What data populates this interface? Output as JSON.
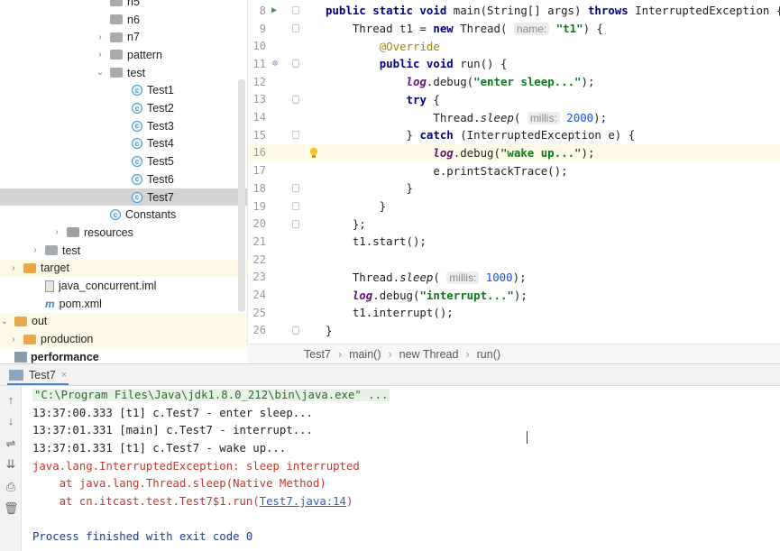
{
  "tree": {
    "items": [
      {
        "label": "n5",
        "indent": 8,
        "arrow": "",
        "icon": "package-icon"
      },
      {
        "label": "n6",
        "indent": 8,
        "arrow": "",
        "icon": "package-icon"
      },
      {
        "label": "n7",
        "indent": 8,
        "arrow": "›",
        "icon": "package-icon"
      },
      {
        "label": "pattern",
        "indent": 8,
        "arrow": "›",
        "icon": "package-icon"
      },
      {
        "label": "test",
        "indent": 8,
        "arrow": "⌄",
        "icon": "package-icon"
      },
      {
        "label": "Test1",
        "indent": 10,
        "arrow": "",
        "icon": "class-icon"
      },
      {
        "label": "Test2",
        "indent": 10,
        "arrow": "",
        "icon": "class-icon"
      },
      {
        "label": "Test3",
        "indent": 10,
        "arrow": "",
        "icon": "class-icon"
      },
      {
        "label": "Test4",
        "indent": 10,
        "arrow": "",
        "icon": "class-icon"
      },
      {
        "label": "Test5",
        "indent": 10,
        "arrow": "",
        "icon": "class-icon"
      },
      {
        "label": "Test6",
        "indent": 10,
        "arrow": "",
        "icon": "class-icon"
      },
      {
        "label": "Test7",
        "indent": 10,
        "arrow": "",
        "icon": "class-icon"
      },
      {
        "label": "Constants",
        "indent": 8,
        "arrow": "",
        "icon": "class-icon"
      },
      {
        "label": "resources",
        "indent": 4,
        "arrow": "›",
        "icon": "resources-folder-icon"
      },
      {
        "label": "test",
        "indent": 2,
        "arrow": "›",
        "icon": "folder-icon"
      },
      {
        "label": "target",
        "indent": 0,
        "arrow": "›",
        "icon": "excluded-folder-icon"
      },
      {
        "label": "java_concurrent.iml",
        "indent": 2,
        "arrow": "",
        "icon": "iml-file-icon"
      },
      {
        "label": "pom.xml",
        "indent": 2,
        "arrow": "",
        "icon": "maven-icon"
      },
      {
        "label": "out",
        "indent": -1,
        "arrow": "⌄",
        "icon": "excluded-folder-icon"
      },
      {
        "label": "production",
        "indent": 0,
        "arrow": "›",
        "icon": "excluded-folder-icon"
      },
      {
        "label": "performance",
        "indent": -1,
        "arrow": "",
        "icon": "module-icon"
      }
    ]
  },
  "editor": {
    "lines": [
      {
        "n": "8",
        "html": "<span class=\"kw\">public static void</span> main(String[] args) <span class=\"kw\">throws</span> InterruptedException {"
      },
      {
        "n": "9",
        "html": "    Thread t1 = <span class=\"kw\">new</span> Thread( <span class=\"hint\">name:</span> <span class=\"str\">\"t1\"</span>) {"
      },
      {
        "n": "10",
        "html": "        <span class=\"ann\">@Override</span>"
      },
      {
        "n": "11",
        "html": "        <span class=\"kw\">public void</span> run() {"
      },
      {
        "n": "12",
        "html": "            <span class=\"logv\">log</span>.debug(<span class=\"str\">\"enter sleep...\"</span>);"
      },
      {
        "n": "13",
        "html": "            <span class=\"kw\">try</span> {"
      },
      {
        "n": "14",
        "html": "                Thread.<span class=\"stat\">sleep</span>( <span class=\"hint\">millis:</span> <span class=\"num\">2000</span>);"
      },
      {
        "n": "15",
        "html": "            } <span class=\"kw\">catch</span> (InterruptedException e) {"
      },
      {
        "n": "16",
        "html": "                <span class=\"logv\">log</span>.debug(<span class=\"str\">\"wake up...\"</span>);"
      },
      {
        "n": "17",
        "html": "                e.printStackTrace();"
      },
      {
        "n": "18",
        "html": "            }"
      },
      {
        "n": "19",
        "html": "        }"
      },
      {
        "n": "20",
        "html": "    };"
      },
      {
        "n": "21",
        "html": "    t1.start();"
      },
      {
        "n": "22",
        "html": ""
      },
      {
        "n": "23",
        "html": "    Thread.<span class=\"stat\">sleep</span>( <span class=\"hint\">millis:</span> <span class=\"num\">1000</span>);"
      },
      {
        "n": "24",
        "html": "    <span class=\"logv\">log</span>.debug(<span class=\"str\">\"interrupt...\"</span>);"
      },
      {
        "n": "25",
        "html": "    t1.interrupt();"
      },
      {
        "n": "26",
        "html": "}"
      }
    ]
  },
  "breadcrumb": {
    "items": [
      "Test7",
      "main()",
      "new Thread",
      "run()"
    ]
  },
  "run": {
    "tab_label": "Test7",
    "close_glyph": "×",
    "toolbar": [
      {
        "name": "up-arrow-icon",
        "glyph": "↑"
      },
      {
        "name": "down-arrow-icon",
        "glyph": "↓"
      },
      {
        "name": "soft-wrap-icon",
        "glyph": "⇌"
      },
      {
        "name": "scroll-to-end-icon",
        "glyph": "⇊"
      },
      {
        "name": "print-icon",
        "glyph": "⎙"
      },
      {
        "name": "trash-icon",
        "glyph": "🗑"
      }
    ],
    "console": [
      {
        "kind": "cmd",
        "text": "\"C:\\Program Files\\Java\\jdk1.8.0_212\\bin\\java.exe\" ..."
      },
      {
        "kind": "out",
        "text": "13:37:00.333 [t1] c.Test7 - enter sleep..."
      },
      {
        "kind": "out",
        "text": "13:37:01.331 [main] c.Test7 - interrupt..."
      },
      {
        "kind": "out",
        "text": "13:37:01.331 [t1] c.Test7 - wake up..."
      },
      {
        "kind": "err",
        "text": "java.lang.InterruptedException: sleep interrupted"
      },
      {
        "kind": "err",
        "text": "    at java.lang.Thread.sleep(Native Method)"
      },
      {
        "kind": "errlink",
        "text": "    at cn.itcast.test.Test7$1.run(",
        "link": "Test7.java:14",
        "after": ")"
      },
      {
        "kind": "blank",
        "text": ""
      },
      {
        "kind": "exit",
        "text": "Process finished with exit code 0"
      }
    ]
  }
}
